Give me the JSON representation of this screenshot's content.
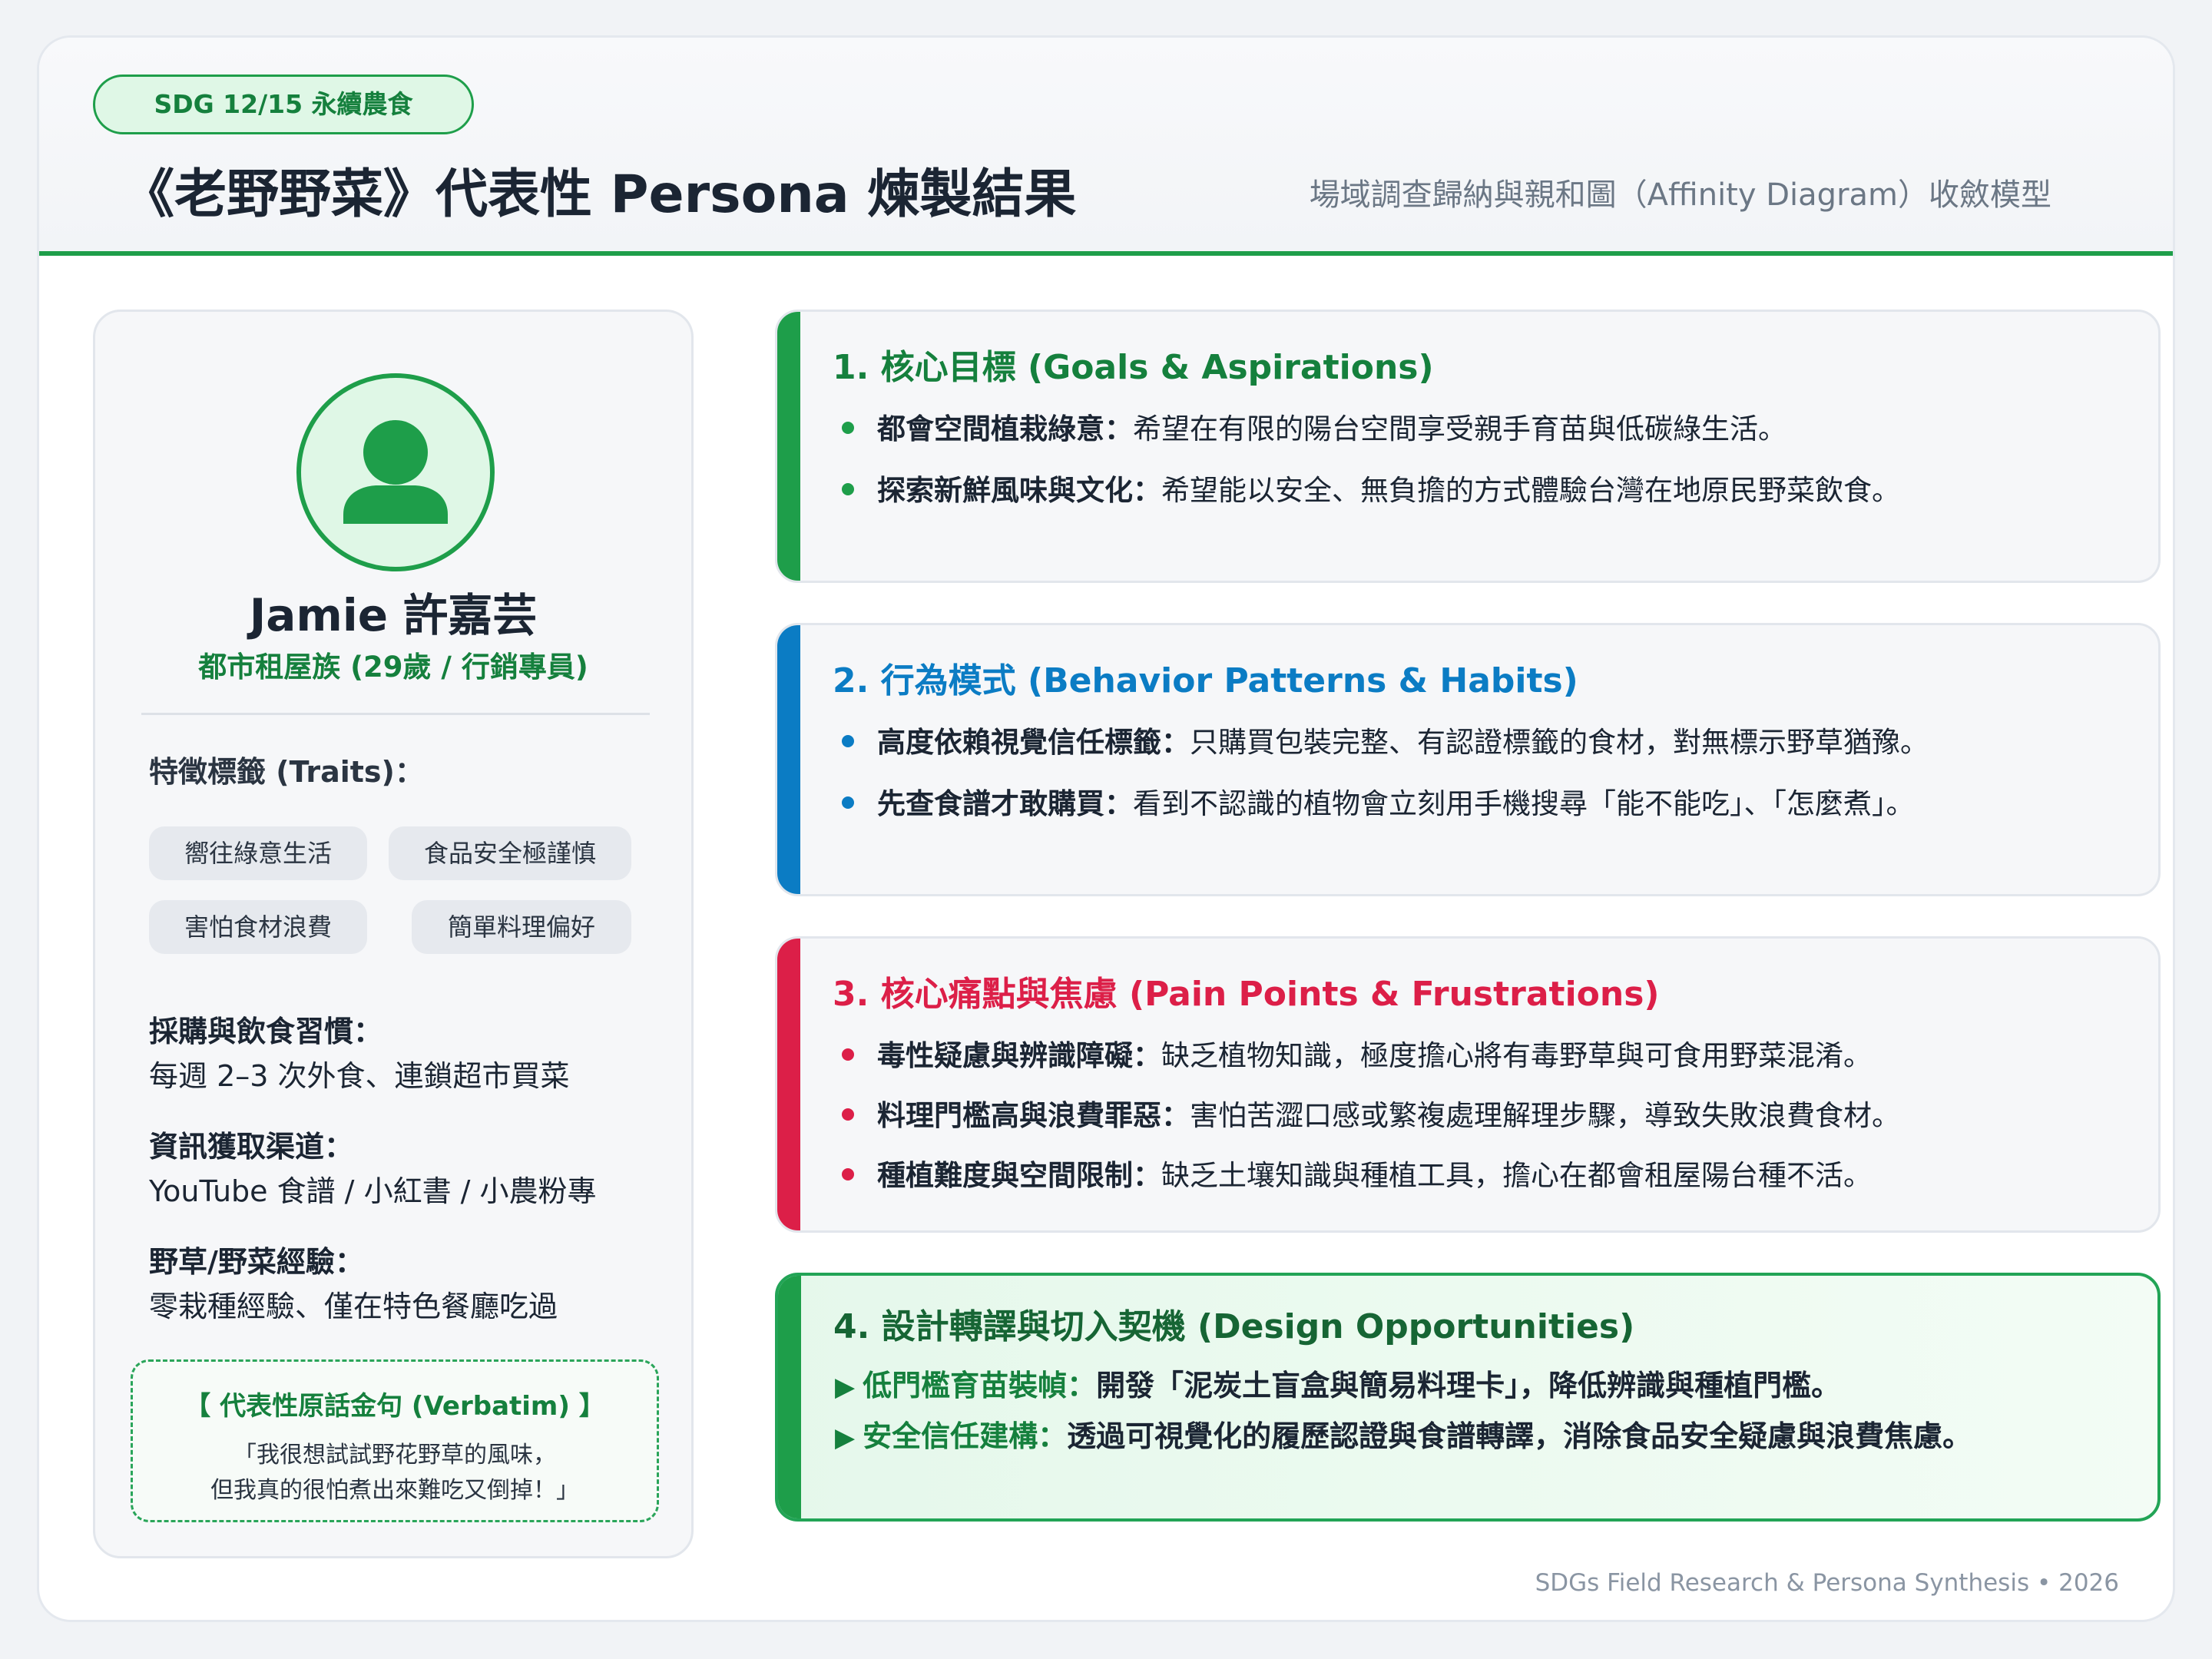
{
  "header": {
    "badge": "SDG 12/15 永續農食",
    "title": "《老野野菜》代表性 Persona 煉製結果",
    "subtitle": "場域調查歸納與親和圖（Affinity Diagram）收斂模型"
  },
  "persona": {
    "avatar_icon": "user-icon",
    "name": "Jamie 許嘉芸",
    "role": "都市租屋族 (29歲 / 行銷專員)",
    "traits_label": "特徵標籤 (Traits)：",
    "traits": [
      "嚮往綠意生活",
      "食品安全極謹慎",
      "害怕食材浪費",
      "簡單料理偏好"
    ],
    "info": [
      {
        "label": "採購與飲食習慣：",
        "value": "每週 2–3 次外食、連鎖超市買菜"
      },
      {
        "label": "資訊獲取渠道：",
        "value": "YouTube 食譜 / 小紅書 / 小農粉專"
      },
      {
        "label": "野草/野菜經驗：",
        "value": "零栽種經驗、僅在特色餐廳吃過"
      }
    ],
    "quote": {
      "title": "【 代表性原話金句 (Verbatim) 】",
      "line1": "「我很想試試野花野草的風味，",
      "line2": "但我真的很怕煮出來難吃又倒掉！」"
    }
  },
  "sections": [
    {
      "title": "1. 核心目標 (Goals & Aspirations)",
      "color": "#1e9e4a",
      "items": [
        {
          "lead": "都會空間植栽綠意：",
          "text": "希望在有限的陽台空間享受親手育苗與低碳綠生活。"
        },
        {
          "lead": "探索新鮮風味與文化：",
          "text": "希望能以安全、無負擔的方式體驗台灣在地原民野菜飲食。"
        }
      ]
    },
    {
      "title": "2. 行為模式 (Behavior Patterns & Habits)",
      "color": "#0b7cc4",
      "items": [
        {
          "lead": "高度依賴視覺信任標籤：",
          "text": "只購買包裝完整、有認證標籤的食材，對無標示野草猶豫。"
        },
        {
          "lead": "先查食譜才敢購買：",
          "text": "看到不認識的植物會立刻用手機搜尋「能不能吃」、「怎麼煮」。"
        }
      ]
    },
    {
      "title": "3. 核心痛點與焦慮 (Pain Points & Frustrations)",
      "color": "#dc1f48",
      "items": [
        {
          "lead": "毒性疑慮與辨識障礙：",
          "text": "缺乏植物知識，極度擔心將有毒野草與可食用野菜混淆。"
        },
        {
          "lead": "料理門檻高與浪費罪惡：",
          "text": "害怕苦澀口感或繁複處理解理步驟，導致失敗浪費食材。"
        },
        {
          "lead": "種植難度與空間限制：",
          "text": "缺乏土壤知識與種植工具，擔心在都會租屋陽台種不活。"
        }
      ]
    },
    {
      "title": "4. 設計轉譯與切入契機 (Design Opportunities)",
      "color": "#15803d",
      "items": [
        {
          "arrow": "▶",
          "lead": "低門檻育苗裝幀：",
          "text": "開發「泥炭土盲盒與簡易料理卡」，降低辨識與種植門檻。"
        },
        {
          "arrow": "▶",
          "lead": "安全信任建構：",
          "text": "透過可視覺化的履歷認證與食譜轉譯，消除食品安全疑慮與浪費焦慮。"
        }
      ]
    }
  ],
  "footer": "SDGs Field Research & Persona Synthesis • 2026"
}
